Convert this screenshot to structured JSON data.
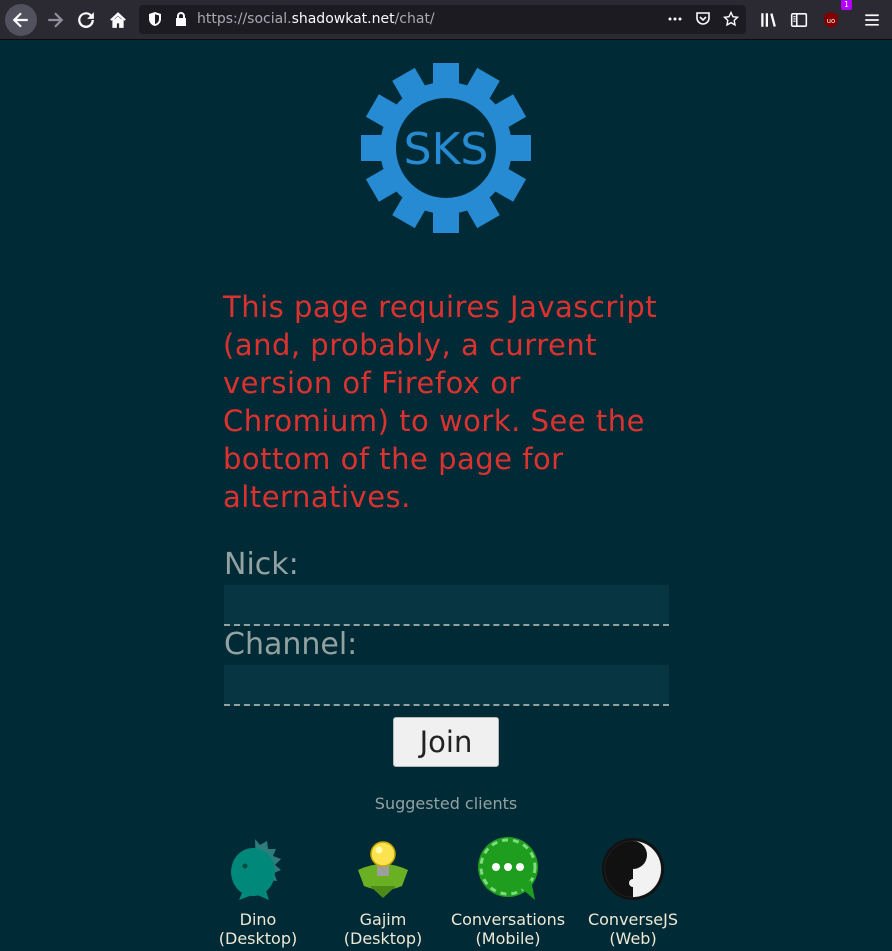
{
  "browser": {
    "url_prefix": "https://social.",
    "url_domain": "shadowkat.net",
    "url_path": "/chat/",
    "ublock_count": "1"
  },
  "page": {
    "logo_text": "SKS",
    "notice": "This page requires Javascript (and, probably, a current version of Firefox or Chromium) to work. See the bottom of the page for alternatives.",
    "nick_label": "Nick:",
    "nick_value": "",
    "channel_label": "Channel:",
    "channel_value": "",
    "join_label": "Join",
    "suggested_heading": "Suggested clients",
    "clients": [
      {
        "name": "Dino",
        "type": "(Desktop)",
        "icon": "dino-icon"
      },
      {
        "name": "Gajim",
        "type": "(Desktop)",
        "icon": "gajim-icon"
      },
      {
        "name": "Conversations",
        "type": "(Mobile)",
        "icon": "conversations-icon"
      },
      {
        "name": "ConverseJS",
        "type": "(Web)",
        "icon": "conversejs-icon"
      }
    ]
  },
  "colors": {
    "background": "#002b36",
    "notice": "#dc322f",
    "logo_blue": "#268bd2",
    "label": "#93a1a1"
  }
}
